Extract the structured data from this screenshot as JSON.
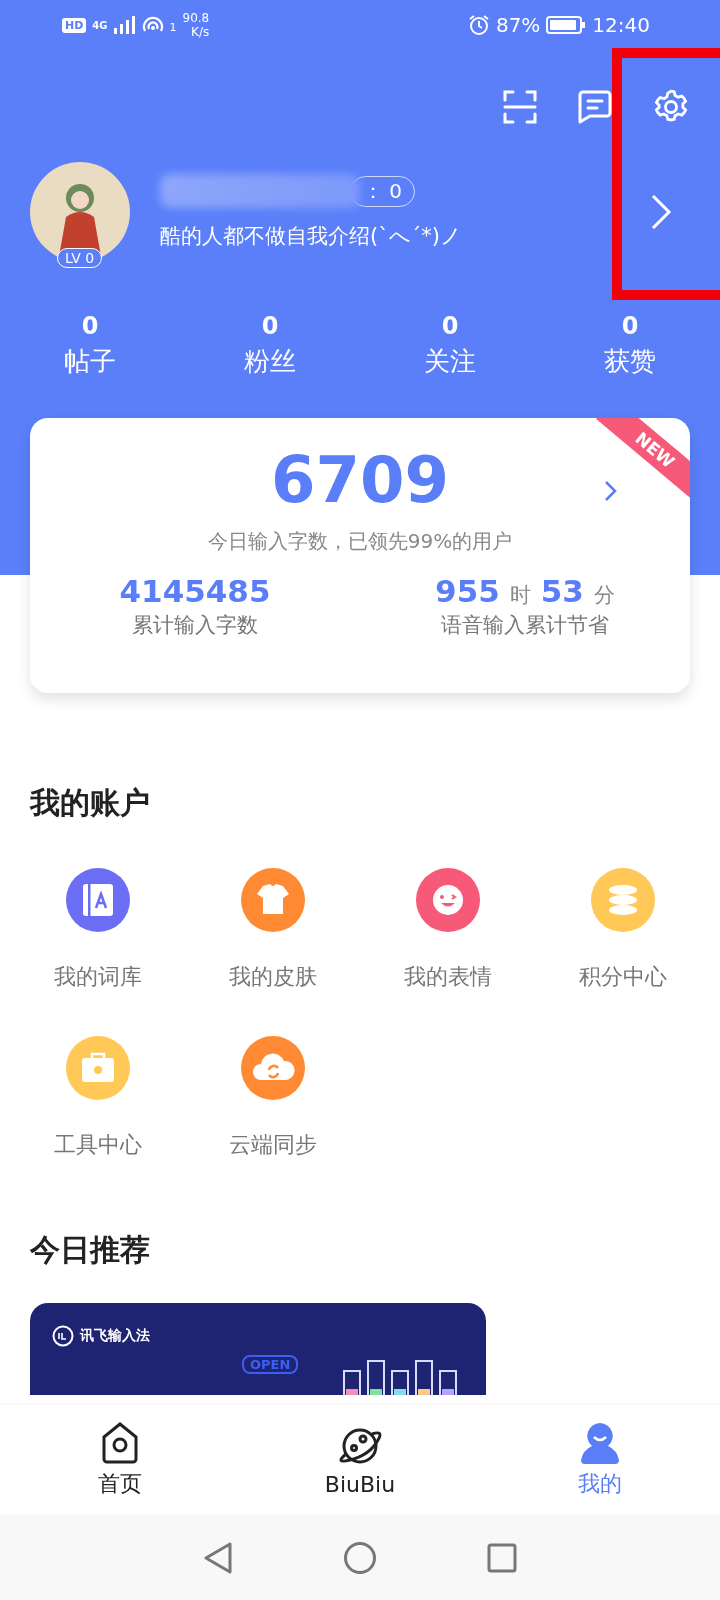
{
  "status_bar": {
    "hd": "HD",
    "network": "4G",
    "sim": "1",
    "speed": "90.8",
    "speed_unit": "K/s",
    "battery": "87%",
    "time": "12:40"
  },
  "profile": {
    "badge": "： 0",
    "bio": "酷的人都不做自我介绍(`へ´*)ノ",
    "level": "LV 0"
  },
  "stats": [
    {
      "value": "0",
      "label": "帖子"
    },
    {
      "value": "0",
      "label": "粉丝"
    },
    {
      "value": "0",
      "label": "关注"
    },
    {
      "value": "0",
      "label": "获赞"
    }
  ],
  "summary": {
    "today": "6709",
    "today_caption": "今日输入字数，已领先99%的用户",
    "ribbon": "NEW",
    "total": "4145485",
    "total_caption": "累计输入字数",
    "hours": "955",
    "hours_unit": "时",
    "minutes": "53",
    "minutes_unit": "分",
    "voice_caption": "语音输入累计节省"
  },
  "account": {
    "title": "我的账户",
    "items": [
      {
        "label": "我的词库",
        "kind": "book",
        "color": "#6b6ef5"
      },
      {
        "label": "我的皮肤",
        "kind": "shirt",
        "color": "#ff8a33"
      },
      {
        "label": "我的表情",
        "kind": "face",
        "color": "#f75a78"
      },
      {
        "label": "积分中心",
        "kind": "coins",
        "color": "#ffc857"
      },
      {
        "label": "工具中心",
        "kind": "toolbox",
        "color": "#ffc857"
      },
      {
        "label": "云端同步",
        "kind": "cloud",
        "color": "#ff8a33"
      }
    ]
  },
  "recommend": {
    "title": "今日推荐",
    "banner": {
      "brand": "讯飞输入法",
      "tag": "OPEN"
    }
  },
  "tabs": [
    {
      "label": "首页",
      "kind": "home",
      "selected": false
    },
    {
      "label": "BiuBiu",
      "kind": "planet",
      "selected": false
    },
    {
      "label": "我的",
      "kind": "me",
      "selected": true
    }
  ]
}
